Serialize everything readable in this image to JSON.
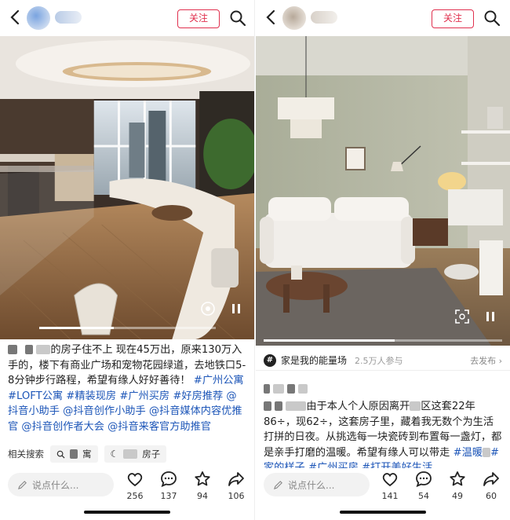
{
  "left": {
    "follow_label": "关注",
    "caption": {
      "p1": "的房子住不上 现在45万出，原来130万入手的，楼下有商业广场和宠物花园绿道，去地铁口5-8分钟步行路程，希望有缘人好好善待！",
      "tags": [
        "#广州公寓",
        "#LOFT公寓",
        "#精装现房",
        "#广州买房",
        "#好房推荐",
        "@抖音小助手",
        "@抖音创作小助手",
        "@抖音媒体内容优推官",
        "@抖音创作者大会",
        "@抖音来客官方助推官"
      ]
    },
    "related": {
      "label": "相关搜索",
      "chip1_suffix": "寓",
      "chip2_suffix": "房子"
    },
    "comment_placeholder": "说点什么...",
    "actions": [
      {
        "icon": "heart-icon",
        "count": "256"
      },
      {
        "icon": "comment-icon",
        "count": "137"
      },
      {
        "icon": "star-icon",
        "count": "94"
      },
      {
        "icon": "share-icon",
        "count": "106"
      }
    ],
    "progress": 0.42
  },
  "right": {
    "follow_label": "关注",
    "topic": {
      "icon": "#",
      "name": "家是我的能量场",
      "count": "2.5万人参与",
      "publish": "去发布 ›"
    },
    "caption": {
      "p1": "由于本人个人原因离开",
      "p2": "区这套22年86÷，现62÷，这套房子里，藏着我无数个为生活打拼的日夜。从挑选每一块瓷砖到布置每一盏灯，都是亲手打磨的温暖。希望有缘人可以带走",
      "tags": [
        "#温暖",
        "#家的样子",
        "#广州买房",
        "#打开美好生活"
      ]
    },
    "comment_placeholder": "说点什么...",
    "actions": [
      {
        "icon": "heart-icon",
        "count": "141"
      },
      {
        "icon": "comment-icon",
        "count": "54"
      },
      {
        "icon": "star-icon",
        "count": "49"
      },
      {
        "icon": "share-icon",
        "count": "60"
      }
    ],
    "progress": 0.55
  },
  "colors": {
    "accent": "#e0304e",
    "tag": "#1d56b8"
  }
}
